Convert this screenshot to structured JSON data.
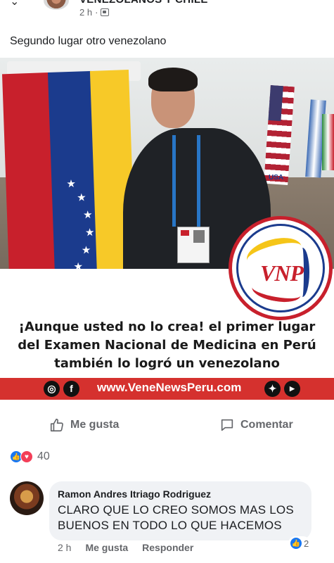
{
  "header": {
    "group_name": "VENEZOLANOS Y CHILE",
    "time": "2 h",
    "separator": "·"
  },
  "post": {
    "text": "Segundo lugar otro venezolano",
    "image": {
      "headline_line1": "¡Aunque usted no lo crea! el primer lugar",
      "headline_line2": "del Examen Nacional de Medicina en Perú",
      "headline_line3": "también lo logró un venezolano",
      "logo_text": "VNP",
      "band_url": "www.VeneNewsPeru.com",
      "flag_label": "USA",
      "social_icons": [
        "instagram-icon",
        "facebook-icon",
        "twitter-icon",
        "youtube-icon"
      ]
    }
  },
  "actions": {
    "like_label": "Me gusta",
    "comment_label": "Comentar"
  },
  "reactions": {
    "count": "40"
  },
  "comment": {
    "author": "Ramon Andres Itriago Rodriguez",
    "text": "CLARO QUE LO CREO SOMOS MAS LOS BUENOS EN TODO LO QUE HACEMOS",
    "time": "2 h",
    "like_label": "Me gusta",
    "reply_label": "Responder",
    "reaction_count": "2"
  },
  "colors": {
    "facebook_blue": "#1877f2",
    "love_red": "#f33e58",
    "band_red": "#d5312e",
    "secondary_text": "#65676b"
  }
}
